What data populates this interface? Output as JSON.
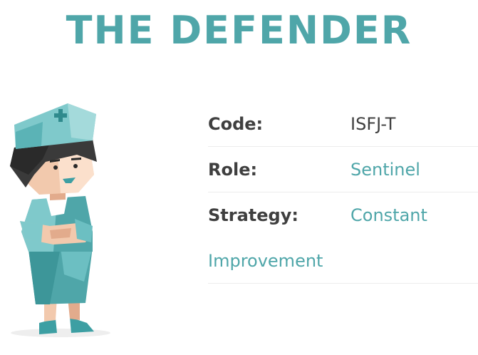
{
  "header": {
    "title": "THE DEFENDER"
  },
  "traits": [
    {
      "label": "Code:",
      "value": "ISFJ-T"
    },
    {
      "label": "Role:",
      "value": "Sentinel"
    },
    {
      "label": "Strategy:",
      "value": "Constant",
      "value_continued": "Improvement"
    }
  ],
  "illustration": {
    "icon": "defender-nurse-character",
    "colors": {
      "teal": "#4fa6a9",
      "teal_light": "#7fc9cb",
      "teal_dark": "#2f8a8d",
      "hair": "#3a3a3a",
      "skin": "#f2c9ad",
      "skin_shade": "#e2ab8c"
    }
  },
  "colors": {
    "accent": "#4fa6a9",
    "text": "#3f3f3f",
    "divider": "#ececec"
  }
}
